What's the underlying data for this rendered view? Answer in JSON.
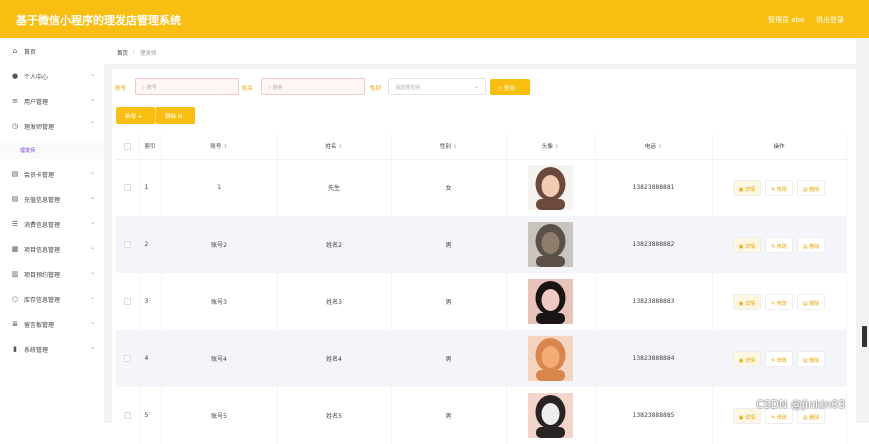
{
  "header": {
    "title": "基于微信小程序的理发店管理系统",
    "user": "管理员 abo",
    "logout": "退出登录"
  },
  "sidebar": {
    "items": [
      {
        "label": "首页",
        "icon": "home-icon",
        "glyph": "⌂",
        "arrow": ""
      },
      {
        "label": "个人中心",
        "icon": "user-icon",
        "glyph": "●",
        "arrow": "⌄"
      },
      {
        "label": "用户管理",
        "icon": "list-icon",
        "glyph": "≡",
        "arrow": "⌄"
      },
      {
        "label": "理发师管理",
        "icon": "clock-icon",
        "glyph": "◷",
        "arrow": "⌃"
      },
      {
        "label": "会员卡管理",
        "icon": "card-icon",
        "glyph": "▤",
        "arrow": "⌄"
      },
      {
        "label": "充值信息管理",
        "icon": "doc-icon",
        "glyph": "▤",
        "arrow": "⌄"
      },
      {
        "label": "消费信息管理",
        "icon": "sliders-icon",
        "glyph": "☰",
        "arrow": "⌄"
      },
      {
        "label": "项目信息管理",
        "icon": "grid-icon",
        "glyph": "▦",
        "arrow": "⌄"
      },
      {
        "label": "项目预约管理",
        "icon": "chart-icon",
        "glyph": "▥",
        "arrow": "⌄"
      },
      {
        "label": "库存信息管理",
        "icon": "circle-icon",
        "glyph": "○",
        "arrow": "⌄"
      },
      {
        "label": "留言板管理",
        "icon": "menu-icon",
        "glyph": "≣",
        "arrow": "⌄"
      },
      {
        "label": "系统管理",
        "icon": "bar-chart-icon",
        "glyph": "▮",
        "arrow": "⌄"
      }
    ],
    "sub_item": "理发师"
  },
  "breadcrumb": {
    "home": "首页",
    "sep": "/",
    "current": "理发师"
  },
  "filters": {
    "account_label": "账号",
    "account_placeholder": "账号",
    "name_label": "姓名",
    "name_placeholder": "姓名",
    "gender_label": "性别",
    "gender_placeholder": "请选择性别",
    "query_button": "查询"
  },
  "actions": {
    "add": "新增",
    "add_glyph": "+",
    "delete": "删除",
    "delete_glyph": "⊟"
  },
  "table": {
    "columns": [
      "索引",
      "账号",
      "姓名",
      "性别",
      "头像",
      "电话",
      "操作"
    ],
    "sort_glyph": "⇕",
    "rows": [
      {
        "index": "1",
        "account": "1",
        "name": "先生",
        "gender": "女",
        "phone": "13823888881",
        "avatar": [
          "#f3cbb2",
          "#6b4a3d",
          "#f6f2f0"
        ]
      },
      {
        "index": "2",
        "account": "账号2",
        "name": "姓名2",
        "gender": "男",
        "phone": "13823888882",
        "avatar": [
          "#8e7d6d",
          "#5b5149",
          "#c9c4bd"
        ]
      },
      {
        "index": "3",
        "account": "账号3",
        "name": "姓名3",
        "gender": "男",
        "phone": "13823888883",
        "avatar": [
          "#f1c9c4",
          "#1a1414",
          "#e8c3ba"
        ]
      },
      {
        "index": "4",
        "account": "账号4",
        "name": "姓名4",
        "gender": "男",
        "phone": "13823888884",
        "avatar": [
          "#f5ab74",
          "#d9854e",
          "#f4d3bf"
        ]
      },
      {
        "index": "5",
        "account": "账号5",
        "name": "姓名5",
        "gender": "男",
        "phone": "13823888885",
        "avatar": [
          "#eeeeee",
          "#2a2323",
          "#f3d5cc"
        ]
      }
    ],
    "ops": {
      "detail": "详情",
      "detail_glyph": "▣",
      "edit": "修改",
      "edit_glyph": "✎",
      "delete": "删除",
      "delete_glyph": "▤"
    }
  },
  "watermark": "CSDN @jinkin03",
  "colors": {
    "brand": "#f8bf12",
    "accent_text": "#e6a400",
    "active_sub": "#7b3ec9"
  }
}
